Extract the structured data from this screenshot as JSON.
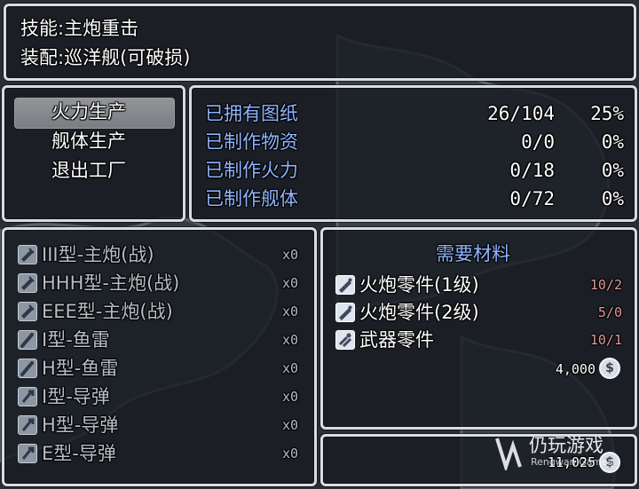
{
  "info": {
    "skill_line": "技能:主炮重击",
    "equip_line": "装配:巡洋舰(可破损)"
  },
  "menu": {
    "items": [
      "火力生产",
      "舰体生产",
      "退出工厂"
    ],
    "selected_index": 0
  },
  "stats": [
    {
      "label": "已拥有图纸",
      "count": "26/104",
      "pct": "25%"
    },
    {
      "label": "已制作物资",
      "count": "0/0",
      "pct": "0%"
    },
    {
      "label": "已制作火力",
      "count": "0/18",
      "pct": "0%"
    },
    {
      "label": "已制作舰体",
      "count": "0/72",
      "pct": "0%"
    }
  ],
  "items": [
    {
      "name": "III型-主炮(战)",
      "qty": "x0",
      "icon": "cannon-icon"
    },
    {
      "name": "HHH型-主炮(战)",
      "qty": "x0",
      "icon": "cannon-icon"
    },
    {
      "name": "EEE型-主炮(战)",
      "qty": "x0",
      "icon": "cannon-icon"
    },
    {
      "name": "I型-鱼雷",
      "qty": "x0",
      "icon": "torpedo-icon"
    },
    {
      "name": "H型-鱼雷",
      "qty": "x0",
      "icon": "torpedo-icon"
    },
    {
      "name": "I型-导弹",
      "qty": "x0",
      "icon": "missile-icon"
    },
    {
      "name": "H型-导弹",
      "qty": "x0",
      "icon": "missile-icon"
    },
    {
      "name": "E型-导弹",
      "qty": "x0",
      "icon": "missile-icon"
    }
  ],
  "materials": {
    "title": "需要材料",
    "list": [
      {
        "name": "火炮零件(1级)",
        "amount": "10/2",
        "icon": "cannon-part-icon"
      },
      {
        "name": "火炮零件(2级)",
        "amount": "5/0",
        "icon": "cannon-part-icon"
      },
      {
        "name": "武器零件",
        "amount": "10/1",
        "icon": "weapon-part-icon"
      }
    ],
    "cost": "4,000",
    "coin_symbol": "$"
  },
  "gold": {
    "amount": "11,025",
    "coin_symbol": "$"
  },
  "watermark": {
    "title": "仍玩游戏",
    "subtitle": "Rengwan Games"
  },
  "colors": {
    "accent_blue": "#8fb4ff",
    "amount_red": "#e39a9a",
    "border": "#d9dde2"
  }
}
